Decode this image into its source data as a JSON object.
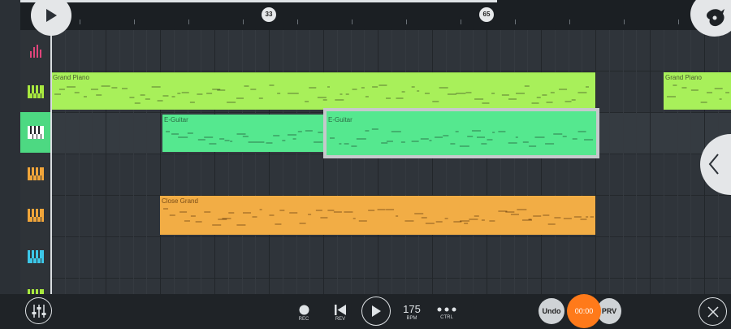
{
  "ruler": {
    "markers": [
      "33",
      "65"
    ]
  },
  "tracks": [
    {
      "id": "drums",
      "icon": "drum-bars-icon",
      "color": "#e0457b"
    },
    {
      "id": "grand-piano",
      "icon": "piano-keys-icon",
      "color": "#a8e83f"
    },
    {
      "id": "e-guitar",
      "icon": "piano-keys-icon",
      "color": "#4dd982",
      "selected": true
    },
    {
      "id": "close-grand-1",
      "icon": "piano-keys-icon",
      "color": "#f0a53a"
    },
    {
      "id": "close-grand-2",
      "icon": "piano-keys-icon",
      "color": "#f0a53a"
    },
    {
      "id": "track-6",
      "icon": "piano-keys-icon",
      "color": "#3cc7e8"
    },
    {
      "id": "track-7",
      "icon": "piano-keys-icon",
      "color": "#a8e83f"
    }
  ],
  "patterns": {
    "grand_piano_1": {
      "label": "Grand Piano",
      "color": "#a8f05a"
    },
    "grand_piano_2": {
      "label": "Grand Piano",
      "color": "#a8f05a"
    },
    "e_guitar_1": {
      "label": "E-Guitar",
      "color": "#55e88f"
    },
    "e_guitar_2": {
      "label": "E-Guitar",
      "color": "#55e88f"
    },
    "close_grand": {
      "label": "Close Grand",
      "color": "#f2ad45"
    }
  },
  "transport": {
    "rec_label": "REC",
    "rev_label": "REV",
    "tempo_value": "175",
    "tempo_label": "BPM",
    "ctrl_label": "CTRL",
    "undo_label": "Undo",
    "time_value": "00:00",
    "prv_label": "PRV"
  },
  "colors": {
    "accent": "#ff7a1a",
    "background": "#2b3036"
  }
}
